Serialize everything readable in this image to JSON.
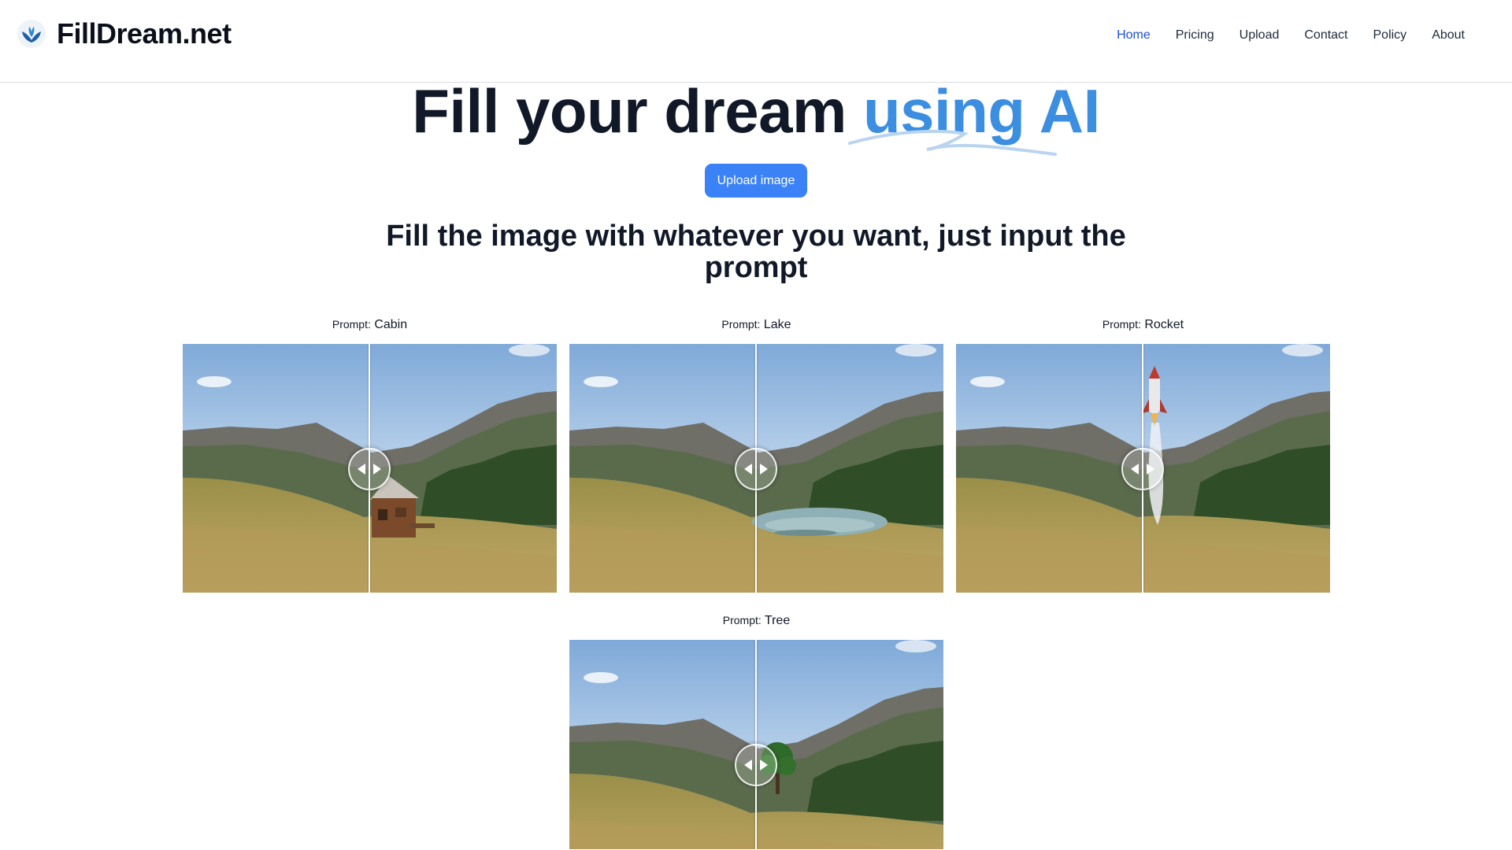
{
  "brand": {
    "name": "FillDream.net",
    "logo_icon": "lotus-leaf-icon",
    "accent": "#3b8ee0"
  },
  "nav": {
    "items": [
      {
        "label": "Home",
        "active": true
      },
      {
        "label": "Pricing",
        "active": false
      },
      {
        "label": "Upload",
        "active": false
      },
      {
        "label": "Contact",
        "active": false
      },
      {
        "label": "Policy",
        "active": false
      },
      {
        "label": "About",
        "active": false
      }
    ]
  },
  "hero": {
    "title_main": "Fill your dream ",
    "title_accent": "using AI",
    "upload_label": "Upload image",
    "subtitle": "Fill the image with whatever you want, just input the prompt"
  },
  "examples": [
    {
      "prompt_key": "Prompt:",
      "prompt_value": "Cabin"
    },
    {
      "prompt_key": "Prompt:",
      "prompt_value": "Lake"
    },
    {
      "prompt_key": "Prompt:",
      "prompt_value": "Rocket"
    },
    {
      "prompt_key": "Prompt:",
      "prompt_value": "Tree"
    }
  ],
  "colors": {
    "button": "#3b82f6",
    "nav_active": "#1d4ed8",
    "title": "#111827"
  }
}
